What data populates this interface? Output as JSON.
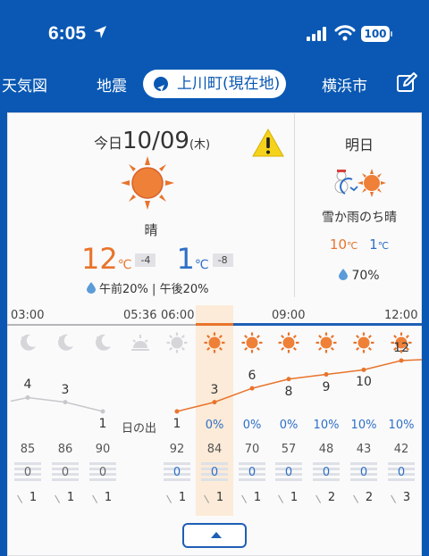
{
  "status_bar": {
    "time": "6:05",
    "battery": "100"
  },
  "nav": {
    "tabs": [
      "天気図",
      "地震",
      "横浜市"
    ],
    "active_tab": "上川町(現在地)"
  },
  "today": {
    "prefix": "今日",
    "date": "10/09",
    "weekday": "(木)",
    "condition": "晴",
    "high": "12",
    "high_diff": "-4",
    "low": "1",
    "low_diff": "-8",
    "unit": "℃",
    "rain_am": "午前20%",
    "separator": "|",
    "rain_pm": "午後20%"
  },
  "tomorrow": {
    "title": "明日",
    "condition": "雪か雨のち晴",
    "high": "10",
    "low": "1",
    "unit": "℃",
    "rain": "70%"
  },
  "timeline": {
    "labels": [
      "03:00",
      "05:36",
      "06:00",
      "09:00",
      "12:00"
    ],
    "sunrise_label": "日の出",
    "icons": [
      "moon-icon",
      "moon-icon",
      "moon-icon",
      "sunrise-icon",
      "sun-grey-icon",
      "sun-icon",
      "sun-icon",
      "sun-icon",
      "sun-icon",
      "sun-icon",
      "sun-icon"
    ],
    "temps": [
      "4",
      "3",
      "1",
      "1",
      "3",
      "6",
      "8",
      "9",
      "10",
      "12"
    ],
    "pop": [
      "0%",
      "0%",
      "0%",
      "10%",
      "10%",
      "10%"
    ],
    "humidity": [
      "85",
      "86",
      "90",
      "92",
      "84",
      "70",
      "57",
      "48",
      "43",
      "42"
    ],
    "precip": [
      "0",
      "0",
      "0",
      "0",
      "0",
      "0",
      "0",
      "0",
      "0",
      "0"
    ],
    "wind": [
      "1",
      "1",
      "1",
      "1",
      "1",
      "1",
      "1",
      "2",
      "2",
      "3"
    ]
  },
  "colors": {
    "header_blue": "#0a58b4",
    "high_orange": "#e8742c",
    "low_blue": "#2f6fc6",
    "highlight": "#fcebd8",
    "warning_yellow": "#f5d21c"
  }
}
